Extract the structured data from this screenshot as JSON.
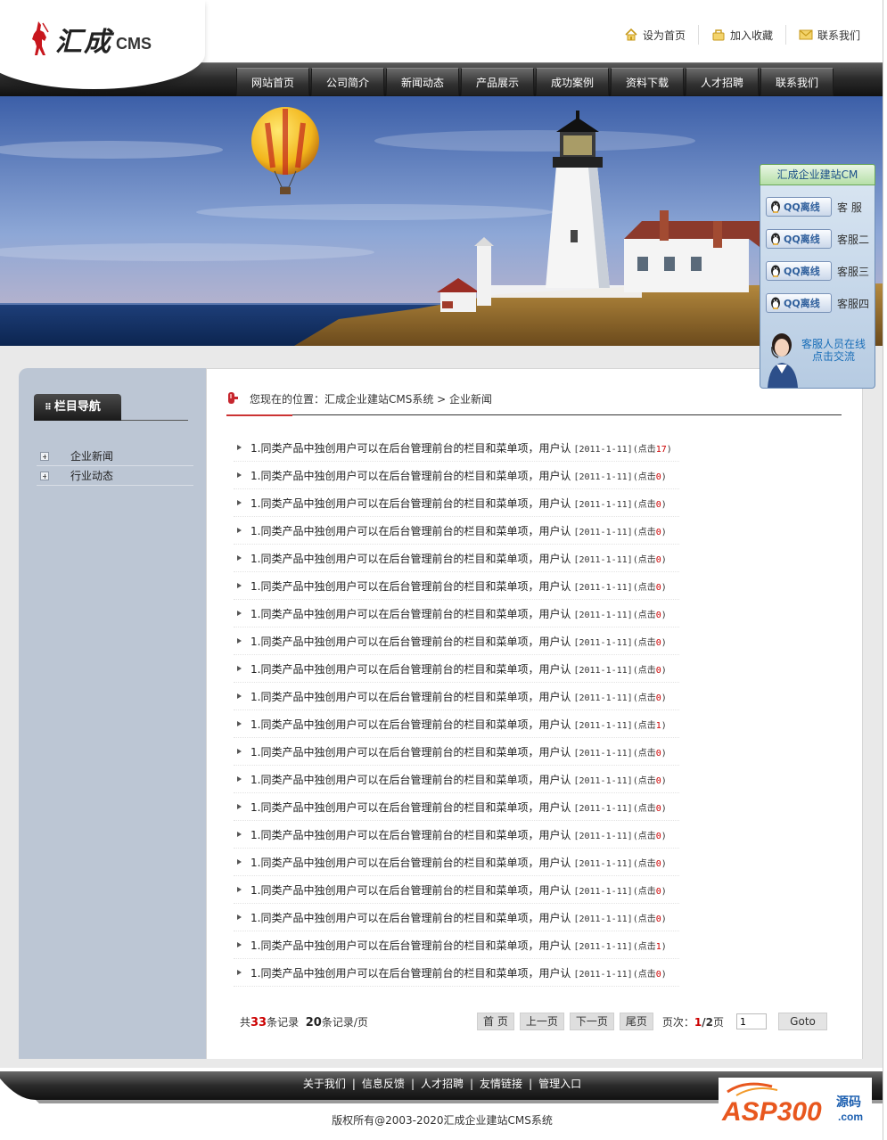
{
  "header": {
    "logo_cn": "汇成",
    "logo_en": "CMS",
    "top_links": [
      {
        "label": "设为首页",
        "icon": "home-icon"
      },
      {
        "label": "加入收藏",
        "icon": "favorite-icon"
      },
      {
        "label": "联系我们",
        "icon": "mail-icon"
      }
    ]
  },
  "nav": {
    "items": [
      "网站首页",
      "公司简介",
      "新闻动态",
      "产品展示",
      "成功案例",
      "资料下载",
      "人才招聘",
      "联系我们"
    ]
  },
  "qq_panel": {
    "title": "汇成企业建站CM",
    "button_text": "QQ离线",
    "agents": [
      "客 服",
      "客服二",
      "客服三",
      "客服四"
    ],
    "service_line1": "客服人员在线",
    "service_line2": "点击交流"
  },
  "sidebar": {
    "title": "栏目导航",
    "items": [
      "企业新闻",
      "行业动态"
    ]
  },
  "breadcrumb": {
    "text": "您现在的位置：汇成企业建站CMS系统 > 企业新闻"
  },
  "news": {
    "rows": [
      {
        "title": "1.同类产品中独创用户可以在后台管理前台的栏目和菜单项，用户认",
        "date": "[2011-1-11]",
        "hits_label": "(点击",
        "hits": "17",
        "close": ")"
      },
      {
        "title": "1.同类产品中独创用户可以在后台管理前台的栏目和菜单项，用户认",
        "date": "[2011-1-11]",
        "hits_label": "(点击",
        "hits": "0",
        "close": ")"
      },
      {
        "title": "1.同类产品中独创用户可以在后台管理前台的栏目和菜单项，用户认",
        "date": "[2011-1-11]",
        "hits_label": "(点击",
        "hits": "0",
        "close": ")"
      },
      {
        "title": "1.同类产品中独创用户可以在后台管理前台的栏目和菜单项，用户认",
        "date": "[2011-1-11]",
        "hits_label": "(点击",
        "hits": "0",
        "close": ")"
      },
      {
        "title": "1.同类产品中独创用户可以在后台管理前台的栏目和菜单项，用户认",
        "date": "[2011-1-11]",
        "hits_label": "(点击",
        "hits": "0",
        "close": ")"
      },
      {
        "title": "1.同类产品中独创用户可以在后台管理前台的栏目和菜单项，用户认",
        "date": "[2011-1-11]",
        "hits_label": "(点击",
        "hits": "0",
        "close": ")"
      },
      {
        "title": "1.同类产品中独创用户可以在后台管理前台的栏目和菜单项，用户认",
        "date": "[2011-1-11]",
        "hits_label": "(点击",
        "hits": "0",
        "close": ")"
      },
      {
        "title": "1.同类产品中独创用户可以在后台管理前台的栏目和菜单项，用户认",
        "date": "[2011-1-11]",
        "hits_label": "(点击",
        "hits": "0",
        "close": ")"
      },
      {
        "title": "1.同类产品中独创用户可以在后台管理前台的栏目和菜单项，用户认",
        "date": "[2011-1-11]",
        "hits_label": "(点击",
        "hits": "0",
        "close": ")"
      },
      {
        "title": "1.同类产品中独创用户可以在后台管理前台的栏目和菜单项，用户认",
        "date": "[2011-1-11]",
        "hits_label": "(点击",
        "hits": "0",
        "close": ")"
      },
      {
        "title": "1.同类产品中独创用户可以在后台管理前台的栏目和菜单项，用户认",
        "date": "[2011-1-11]",
        "hits_label": "(点击",
        "hits": "1",
        "close": ")"
      },
      {
        "title": "1.同类产品中独创用户可以在后台管理前台的栏目和菜单项，用户认",
        "date": "[2011-1-11]",
        "hits_label": "(点击",
        "hits": "0",
        "close": ")"
      },
      {
        "title": "1.同类产品中独创用户可以在后台管理前台的栏目和菜单项，用户认",
        "date": "[2011-1-11]",
        "hits_label": "(点击",
        "hits": "0",
        "close": ")"
      },
      {
        "title": "1.同类产品中独创用户可以在后台管理前台的栏目和菜单项，用户认",
        "date": "[2011-1-11]",
        "hits_label": "(点击",
        "hits": "0",
        "close": ")"
      },
      {
        "title": "1.同类产品中独创用户可以在后台管理前台的栏目和菜单项，用户认",
        "date": "[2011-1-11]",
        "hits_label": "(点击",
        "hits": "0",
        "close": ")"
      },
      {
        "title": "1.同类产品中独创用户可以在后台管理前台的栏目和菜单项，用户认",
        "date": "[2011-1-11]",
        "hits_label": "(点击",
        "hits": "0",
        "close": ")"
      },
      {
        "title": "1.同类产品中独创用户可以在后台管理前台的栏目和菜单项，用户认",
        "date": "[2011-1-11]",
        "hits_label": "(点击",
        "hits": "0",
        "close": ")"
      },
      {
        "title": "1.同类产品中独创用户可以在后台管理前台的栏目和菜单项，用户认",
        "date": "[2011-1-11]",
        "hits_label": "(点击",
        "hits": "0",
        "close": ")"
      },
      {
        "title": "1.同类产品中独创用户可以在后台管理前台的栏目和菜单项，用户认",
        "date": "[2011-1-11]",
        "hits_label": "(点击",
        "hits": "1",
        "close": ")"
      },
      {
        "title": "1.同类产品中独创用户可以在后台管理前台的栏目和菜单项，用户认",
        "date": "[2011-1-11]",
        "hits_label": "(点击",
        "hits": "0",
        "close": ")"
      }
    ]
  },
  "pager": {
    "total_prefix": "共",
    "total": "33",
    "total_suffix": "条记录",
    "per_page": "20",
    "per_page_suffix": "条记录/页",
    "first": "首 页",
    "prev": "上一页",
    "next": "下一页",
    "last": "尾页",
    "page_label": "页次：",
    "current": "1",
    "sep": "/",
    "pages": "2",
    "page_suffix": "页",
    "input_value": "1",
    "goto": "Goto"
  },
  "footer": {
    "links": [
      "关于我们",
      "信息反馈",
      "人才招聘",
      "友情链接",
      "管理入口"
    ],
    "separator": "|",
    "copyright": "版权所有@2003-2020汇成企业建站CMS系统",
    "watermark_text": "ASP300",
    "watermark_cn": "源码",
    "watermark_com": ".com"
  },
  "colors": {
    "nav_dark": "#1a1a1a",
    "sidebar_bg": "#bcc6d4",
    "accent_red": "#cc0000",
    "qq_blue": "#2f5f9c"
  }
}
